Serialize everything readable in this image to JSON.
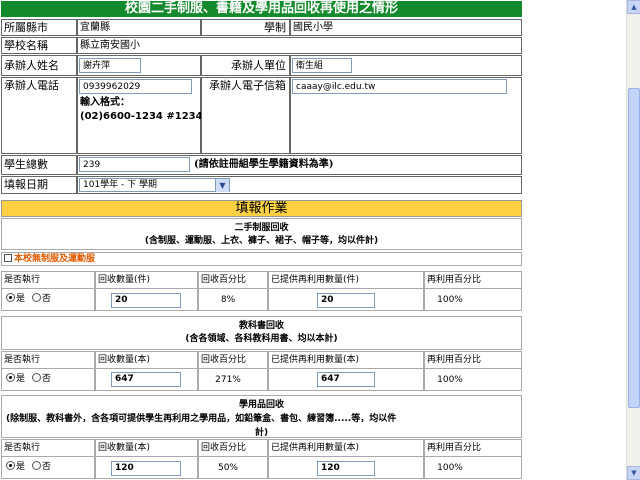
{
  "title": "校園二手制服、書籍及學用品回收再使用之情形",
  "info": {
    "county_label": "所屬縣市",
    "county_value": "宜蘭縣",
    "level_label": "學制",
    "level_value": "國民小學",
    "school_label": "學校名稱",
    "school_value": "縣立南安國小",
    "contact_label": "承辦人姓名",
    "contact_value": "謝卉萍",
    "unit_label": "承辦人單位",
    "unit_value": "衛生組",
    "phone_label": "承辦人電話",
    "phone_value": "0939962029",
    "phone_hint1": "輸入格式：",
    "phone_hint2": "(02)6600-1234 #12345",
    "email_label": "承辦人電子信箱",
    "email_value": "caaay@ilc.edu.tw",
    "students_label": "學生總數",
    "students_value": "239",
    "students_note": "(請依註冊組學生學籍資料為準)",
    "date_label": "填報日期",
    "date_value": "101學年 - 下 學期"
  },
  "report": {
    "band_label": "填報作業",
    "uniform": {
      "title": "二手制服回收",
      "subtitle": "(含制服、運動服、上衣、褲子、裙子、帽子等，均以件計)",
      "no_uniform_label": "本校無制服及運動服",
      "headers": [
        "是否執行",
        "回收數量(件)",
        "回收百分比",
        "已提供再利用數量(件)",
        "再利用百分比"
      ],
      "yes_label": "是",
      "no_label": "否",
      "recycled": "20",
      "recycle_pct": "8%",
      "reused": "20",
      "reuse_pct": "100%"
    },
    "textbook": {
      "title": "教科書回收",
      "subtitle": "(含各領域、各科教科用書、均以本計)",
      "headers": [
        "是否執行",
        "回收數量(本)",
        "回收百分比",
        "已提供再利用數量(本)",
        "再利用百分比"
      ],
      "yes_label": "是",
      "no_label": "否",
      "recycled": "647",
      "recycle_pct": "271%",
      "reused": "647",
      "reuse_pct": "100%"
    },
    "supplies": {
      "title": "學用品回收",
      "subtitle1": "(除制服、教科書外，含各項可提供學生再利用之學用品，如鉛筆盒、書包、練習簿.....等，均以件",
      "subtitle2": "計)",
      "headers": [
        "是否執行",
        "回收數量(本)",
        "回收百分比",
        "已提供再利用數量(本)",
        "再利用百分比"
      ],
      "yes_label": "是",
      "no_label": "否",
      "recycled": "120",
      "recycle_pct": "50%",
      "reused": "120",
      "reuse_pct": "100%"
    }
  },
  "icons": {
    "scroll_up": "scroll-up-arrow-icon",
    "scroll_down": "scroll-down-arrow-icon",
    "dropdown": "chevron-down-icon"
  },
  "colors": {
    "title_bg": "#138a2c",
    "band_bg": "#fbd143",
    "warning_text": "#e05a00"
  }
}
